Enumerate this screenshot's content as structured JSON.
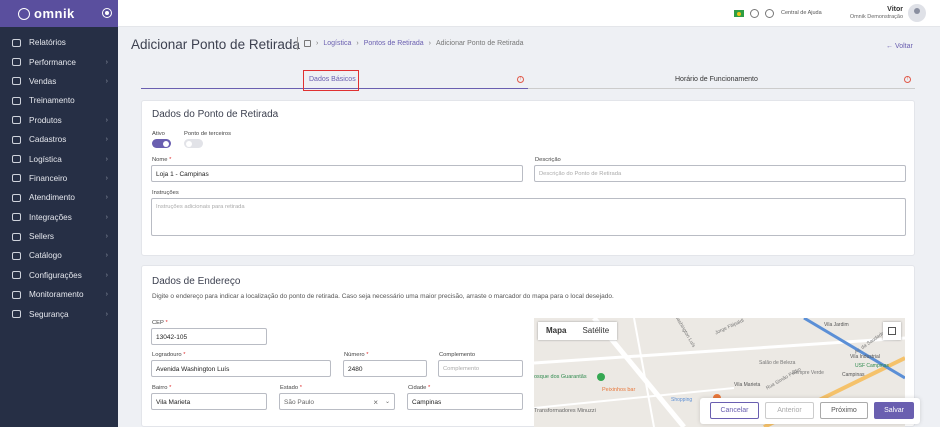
{
  "app": {
    "logo": "omnik"
  },
  "sidebar": {
    "items": [
      {
        "label": "Relatórios",
        "icon": "bar-chart-icon",
        "chevron": false
      },
      {
        "label": "Performance",
        "icon": "pulse-icon",
        "chevron": true
      },
      {
        "label": "Vendas",
        "icon": "cart-icon",
        "chevron": true
      },
      {
        "label": "Treinamento",
        "icon": "book-icon",
        "chevron": false
      },
      {
        "label": "Produtos",
        "icon": "box-icon",
        "chevron": true
      },
      {
        "label": "Cadastros",
        "icon": "folder-icon",
        "chevron": true
      },
      {
        "label": "Logística",
        "icon": "truck-icon",
        "chevron": true
      },
      {
        "label": "Financeiro",
        "icon": "dollar-icon",
        "chevron": true
      },
      {
        "label": "Atendimento",
        "icon": "headset-icon",
        "chevron": true
      },
      {
        "label": "Integrações",
        "icon": "gear-icon",
        "chevron": true
      },
      {
        "label": "Sellers",
        "icon": "store-icon",
        "chevron": true
      },
      {
        "label": "Catálogo",
        "icon": "catalog-icon",
        "chevron": true
      },
      {
        "label": "Configurações",
        "icon": "settings-icon",
        "chevron": true
      },
      {
        "label": "Monitoramento",
        "icon": "monitor-icon",
        "chevron": true
      },
      {
        "label": "Segurança",
        "icon": "key-icon",
        "chevron": true
      }
    ]
  },
  "topbar": {
    "help": "Central de Ajuda",
    "user_name": "Vitor",
    "user_org": "Omnik Demonstração"
  },
  "page": {
    "title": "Adicionar Ponto de Retirada",
    "back": "Voltar"
  },
  "breadcrumb": {
    "items": [
      "Logística",
      "Pontos de Retirada",
      "Adicionar Ponto de Retirada"
    ]
  },
  "tabs": [
    {
      "label": "Dados Básicos"
    },
    {
      "label": "Horário de Funcionamento"
    }
  ],
  "basic": {
    "title": "Dados do Ponto de Retirada",
    "active_label": "Ativo",
    "third_label": "Ponto de terceiros",
    "name_label": "Nome",
    "name_value": "Loja 1 - Campinas",
    "desc_label": "Descrição",
    "desc_placeholder": "Descrição do Ponto de Retirada",
    "instr_label": "Instruções",
    "instr_placeholder": "Instruções adicionais para retirada"
  },
  "address": {
    "title": "Dados de Endereço",
    "help": "Digite o endereço para indicar a localização do ponto de retirada. Caso seja necessário uma maior precisão, arraste o marcador do mapa para o local desejado.",
    "cep_label": "CEP",
    "cep_value": "13042-105",
    "street_label": "Logradouro",
    "street_value": "Avenida Washington Luís",
    "number_label": "Número",
    "number_value": "2480",
    "comp_label": "Complemento",
    "comp_placeholder": "Complemento",
    "district_label": "Bairro",
    "district_value": "Vila Marieta",
    "state_label": "Estado",
    "state_value": "São Paulo",
    "city_label": "Cidade",
    "city_value": "Campinas"
  },
  "map": {
    "tab_map": "Mapa",
    "tab_sat": "Satélite",
    "labels": [
      "Washington Luís",
      "Jorge Fitipaldi",
      "Vila Jardim",
      "Av. da Saudade",
      "Salão de Beleza",
      "Rua Simão Pedro",
      "Vila Marieta",
      "osque dos Guarantãs",
      "Peixinhos bar",
      "Shopping",
      "Transformadores Minuzzi",
      "Sempre Verde",
      "Campinas",
      "Vila Industrial",
      "USF Campinas"
    ]
  },
  "actions": {
    "cancel": "Cancelar",
    "prev": "Anterior",
    "next": "Próximo",
    "save": "Salvar"
  }
}
